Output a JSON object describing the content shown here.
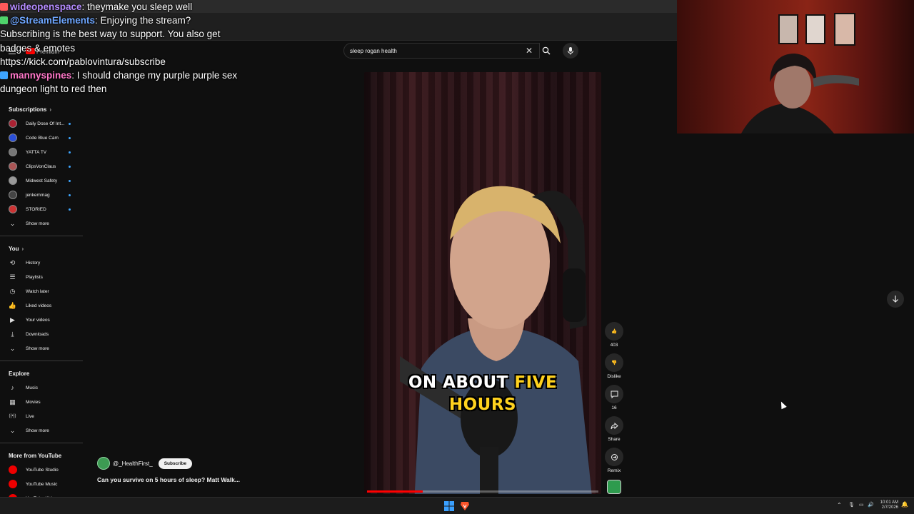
{
  "chat": [
    {
      "user": "wideopenspace",
      "user_color": "#b58cff",
      "badge_color": "#ff5a5a",
      "text": ": theymake you sleep well"
    },
    {
      "user": "@StreamElements",
      "user_color": "#6ea6ff",
      "badge_color": "#4fd36b",
      "text": ": Enjoying the stream? Subscribing is the best way to support. You also get badges & emotes https://kick.com/pablovintura/subscribe"
    },
    {
      "user": "mannyspines",
      "user_color": "#ff77c8",
      "badge_color": "#3ea6ff",
      "text": ": I should change my purple purple sex dungeon light to red then"
    }
  ],
  "masthead": {
    "logo_text": "Premium",
    "search_value": "sleep rogan health",
    "clear_icon": "close-icon",
    "search_icon": "search-icon",
    "mic_icon": "mic-icon"
  },
  "sidebar": {
    "subscriptions_title": "Subscriptions",
    "subscriptions": [
      {
        "label": "Daily Dose Of Int..."
      },
      {
        "label": "Code Blue Cam"
      },
      {
        "label": "YATTA TV"
      },
      {
        "label": "ClipsVonClaus"
      },
      {
        "label": "Midwest Safety"
      },
      {
        "label": "jenkemmag"
      },
      {
        "label": "STORIED"
      }
    ],
    "subs_show_more": "Show more",
    "you_title": "You",
    "you_items": [
      {
        "label": "History",
        "icon": "history-icon",
        "glyph": "⟲"
      },
      {
        "label": "Playlists",
        "icon": "playlists-icon",
        "glyph": "☰"
      },
      {
        "label": "Watch later",
        "icon": "clock-icon",
        "glyph": "◷"
      },
      {
        "label": "Liked videos",
        "icon": "thumbs-up-icon",
        "glyph": "👍"
      },
      {
        "label": "Your videos",
        "icon": "video-icon",
        "glyph": "▶"
      },
      {
        "label": "Downloads",
        "icon": "download-icon",
        "glyph": "⤓"
      }
    ],
    "you_show_more": "Show more",
    "explore_title": "Explore",
    "explore_items": [
      {
        "label": "Music",
        "icon": "music-icon",
        "glyph": "♪"
      },
      {
        "label": "Movies",
        "icon": "movies-icon",
        "glyph": "▦"
      },
      {
        "label": "Live",
        "icon": "live-icon",
        "glyph": "((•))"
      }
    ],
    "explore_show_more": "Show more",
    "more_title": "More from YouTube",
    "more_items": [
      {
        "label": "YouTube Studio"
      },
      {
        "label": "YouTube Music"
      },
      {
        "label": "YouTube Kids"
      }
    ]
  },
  "video": {
    "caption_white": "ON ABOUT",
    "caption_yellow_1": "FIVE",
    "caption_yellow_2": "HOURS",
    "progress": 0.24
  },
  "actions": {
    "likes": "403",
    "dislike": "Dislike",
    "comments": "16",
    "share": "Share",
    "remix": "Remix"
  },
  "channel": {
    "name": "@_HealthFirst_",
    "subscribe": "Subscribe",
    "title": "Can you survive on 5 hours of sleep?  Matt Walk..."
  },
  "taskbar": {
    "time": "10:01 AM",
    "date": "2/7/2026"
  }
}
